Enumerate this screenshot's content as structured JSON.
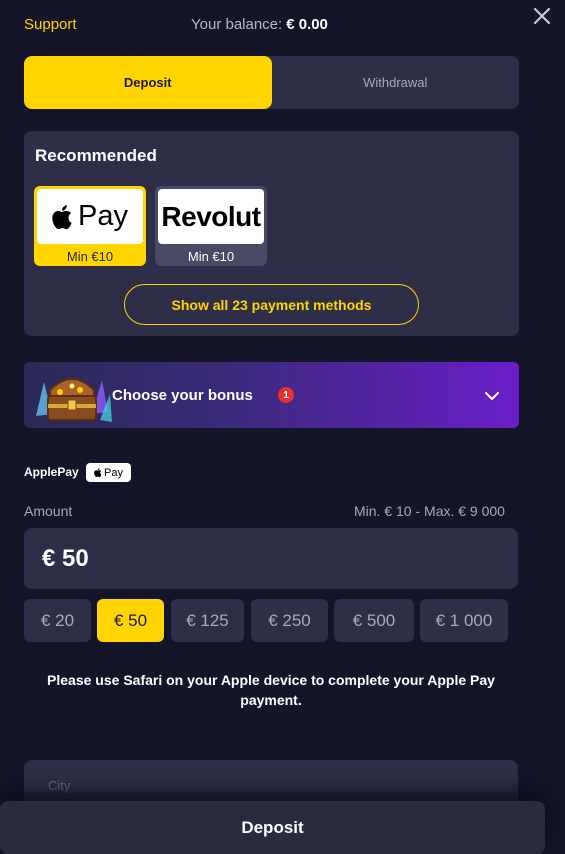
{
  "header": {
    "support_label": "Support",
    "balance_label": "Your balance:",
    "balance_value": "€ 0.00",
    "close_icon": "close-icon"
  },
  "tabs": [
    {
      "label": "Deposit",
      "active": true
    },
    {
      "label": "Withdrawal",
      "active": false
    }
  ],
  "recommended": {
    "title": "Recommended",
    "methods": [
      {
        "name": "Apple Pay",
        "logo_text": "Pay",
        "min": "Min €10",
        "selected": true
      },
      {
        "name": "Revolut",
        "logo_text": "Revolut",
        "min": "Min €10",
        "selected": false
      }
    ],
    "show_all_label": "Show all 23 payment methods"
  },
  "bonus": {
    "label": "Choose your bonus",
    "badge_count": "1",
    "chevron_icon": "chevron-down-icon"
  },
  "method": {
    "label": "ApplePay",
    "pill_text": "Pay"
  },
  "amount": {
    "label": "Amount",
    "limits": "Min. € 10 - Max. € 9 000",
    "value": "€ 50",
    "presets": [
      {
        "label": "€ 20",
        "active": false
      },
      {
        "label": "€ 50",
        "active": true
      },
      {
        "label": "€ 125",
        "active": false
      },
      {
        "label": "€ 250",
        "active": false
      },
      {
        "label": "€ 500",
        "active": false
      },
      {
        "label": "€ 1 000",
        "active": false
      }
    ]
  },
  "notice": "Please use Safari on your Apple device to complete your Apple Pay payment.",
  "city_field": {
    "label": "City"
  },
  "deposit_button": "Deposit",
  "colors": {
    "background": "#15152a",
    "panel": "#2e2e48",
    "accent": "#ffd400",
    "badge": "#e8302c"
  }
}
